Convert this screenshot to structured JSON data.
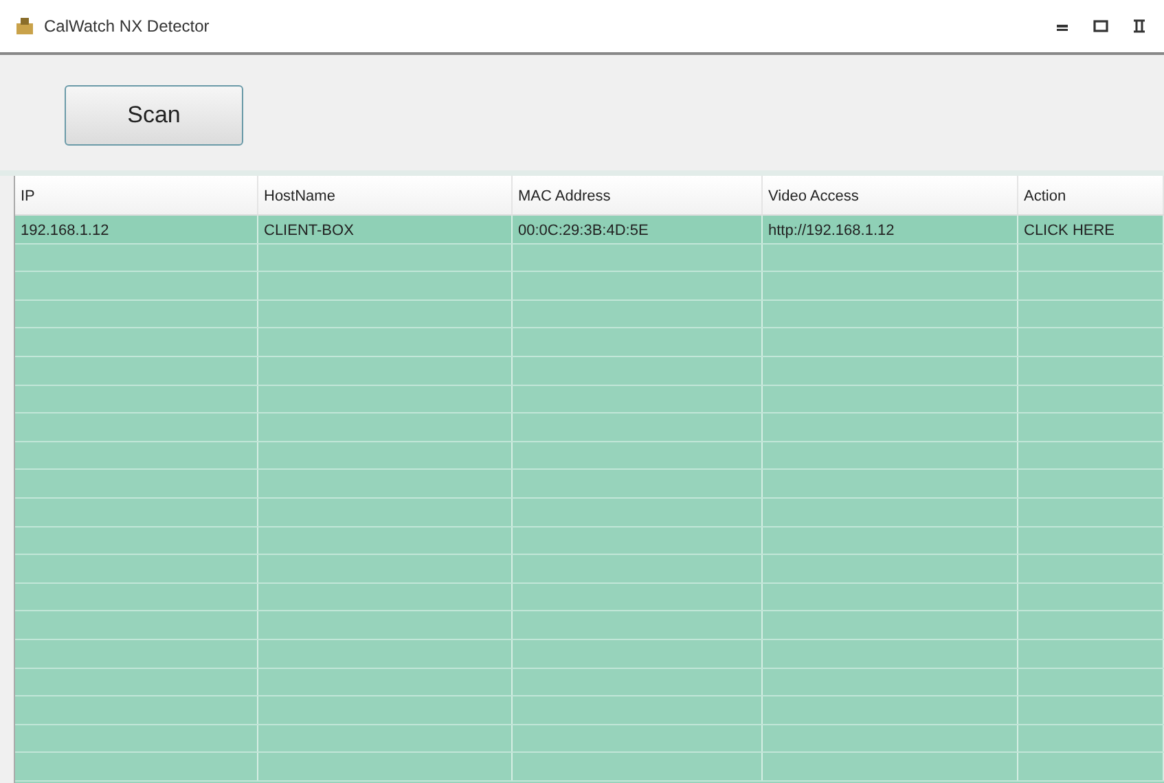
{
  "window": {
    "title": "CalWatch NX Detector"
  },
  "toolbar": {
    "scan_button": "Scan"
  },
  "table": {
    "columns": [
      "IP",
      "HostName",
      "MAC Address",
      "Video Access",
      "Action"
    ],
    "rows": [
      {
        "cells": [
          "192.168.1.12",
          "CLIENT-BOX",
          "00:0C:29:3B:4D:5E",
          "http://192.168.1.12",
          "CLICK HERE"
        ],
        "selected": true
      }
    ]
  }
}
